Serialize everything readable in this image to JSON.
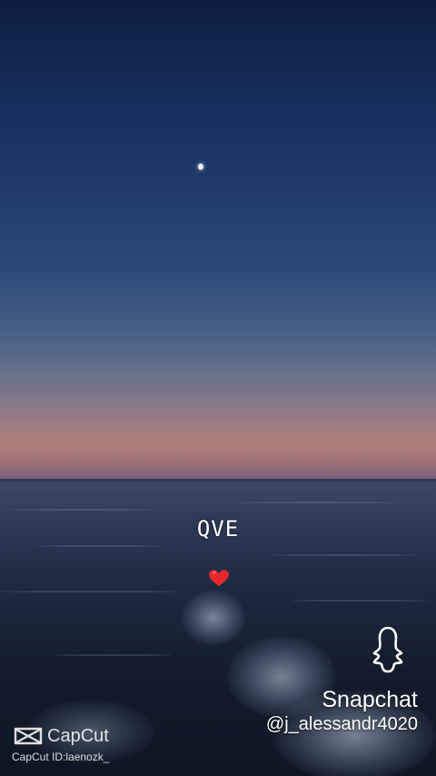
{
  "overlay": {
    "caption": "QVE"
  },
  "snapchat": {
    "label": "Snapchat",
    "handle": "@j_alessandr4020",
    "icon": "ghost-icon"
  },
  "capcut": {
    "name": "CapCut",
    "id_text": "CapCut ID:laenozk_",
    "icon": "capcut-logo-icon"
  },
  "scene": {
    "sky_top_color": "#0e1d40",
    "sunset_color": "#b07e78",
    "sea_color": "#1e2a40",
    "heart_color": "#e8262e"
  }
}
